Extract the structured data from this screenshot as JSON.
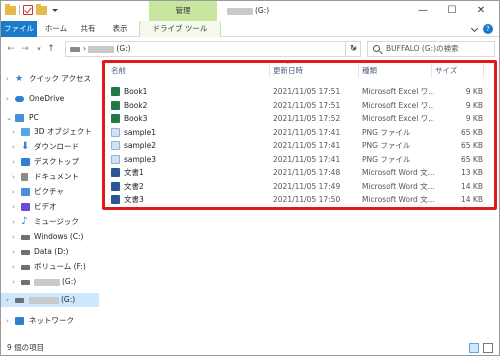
{
  "titlebar": {
    "manage_tab": "管理",
    "title": "(G:)",
    "controls": {
      "minimize": "—",
      "maximize": "☐",
      "close": "✕"
    }
  },
  "ribbon": {
    "tabs": [
      "ファイル",
      "ホーム",
      "共有",
      "表示",
      "ドライブ ツール"
    ],
    "help": "?"
  },
  "address": {
    "path": "(G:)",
    "search_placeholder": "BUFFALO (G:)の検索"
  },
  "nav": {
    "items": [
      {
        "label": "クイック アクセス",
        "icon": "star-icon",
        "color": "#2f7fd6"
      },
      {
        "label": "OneDrive",
        "icon": "cloud-icon",
        "color": "#2f7fd6"
      },
      {
        "label": "PC",
        "icon": "pc-icon",
        "color": "#4a90d9"
      },
      {
        "label": "3D オブジェクト",
        "icon": "cube-icon",
        "color": "#5aa3e8"
      },
      {
        "label": "ダウンロード",
        "icon": "download-icon",
        "color": "#2f7fd6"
      },
      {
        "label": "デスクトップ",
        "icon": "desktop-icon",
        "color": "#2f7fd6"
      },
      {
        "label": "ドキュメント",
        "icon": "document-icon",
        "color": "#8a8a8a"
      },
      {
        "label": "ピクチャ",
        "icon": "picture-icon",
        "color": "#4a90d9"
      },
      {
        "label": "ビデオ",
        "icon": "video-icon",
        "color": "#6a4ad9"
      },
      {
        "label": "ミュージック",
        "icon": "music-icon",
        "color": "#2f7fd6"
      },
      {
        "label": "Windows (C:)",
        "icon": "drive-icon",
        "color": "#6f6f6f"
      },
      {
        "label": "Data (D:)",
        "icon": "drive-icon",
        "color": "#6f6f6f"
      },
      {
        "label": "ボリューム (F:)",
        "icon": "drive-icon",
        "color": "#6f6f6f"
      },
      {
        "label": "(G:)",
        "icon": "drive-icon",
        "color": "#6f6f6f"
      },
      {
        "label": "(G:)",
        "icon": "drive-icon",
        "color": "#6f6f6f"
      },
      {
        "label": "ネットワーク",
        "icon": "network-icon",
        "color": "#2f7fd6"
      }
    ]
  },
  "columns": {
    "name": "名前",
    "date": "更新日時",
    "type": "種類",
    "size": "サイズ"
  },
  "files": [
    {
      "name": "Book1",
      "date": "2021/11/05 17:51",
      "type": "Microsoft Excel ワ...",
      "size": "9 KB",
      "kind": "excel"
    },
    {
      "name": "Book2",
      "date": "2021/11/05 17:51",
      "type": "Microsoft Excel ワ...",
      "size": "9 KB",
      "kind": "excel"
    },
    {
      "name": "Book3",
      "date": "2021/11/05 17:52",
      "type": "Microsoft Excel ワ...",
      "size": "9 KB",
      "kind": "excel"
    },
    {
      "name": "sample1",
      "date": "2021/11/05 17:41",
      "type": "PNG ファイル",
      "size": "65 KB",
      "kind": "png"
    },
    {
      "name": "sample2",
      "date": "2021/11/05 17:41",
      "type": "PNG ファイル",
      "size": "65 KB",
      "kind": "png"
    },
    {
      "name": "sample3",
      "date": "2021/11/05 17:41",
      "type": "PNG ファイル",
      "size": "65 KB",
      "kind": "png"
    },
    {
      "name": "文書1",
      "date": "2021/11/05 17:48",
      "type": "Microsoft Word 文...",
      "size": "13 KB",
      "kind": "word"
    },
    {
      "name": "文書2",
      "date": "2021/11/05 17:49",
      "type": "Microsoft Word 文...",
      "size": "14 KB",
      "kind": "word"
    },
    {
      "name": "文書3",
      "date": "2021/11/05 17:50",
      "type": "Microsoft Word 文...",
      "size": "14 KB",
      "kind": "word"
    }
  ],
  "status": {
    "count": "9 個の項目"
  },
  "colors": {
    "accent": "#1979ca",
    "highlight": "#e01919",
    "manage": "#c8e6a0",
    "excel": "#1f7a44",
    "word": "#2b5797",
    "png": "#cfe3f5"
  }
}
